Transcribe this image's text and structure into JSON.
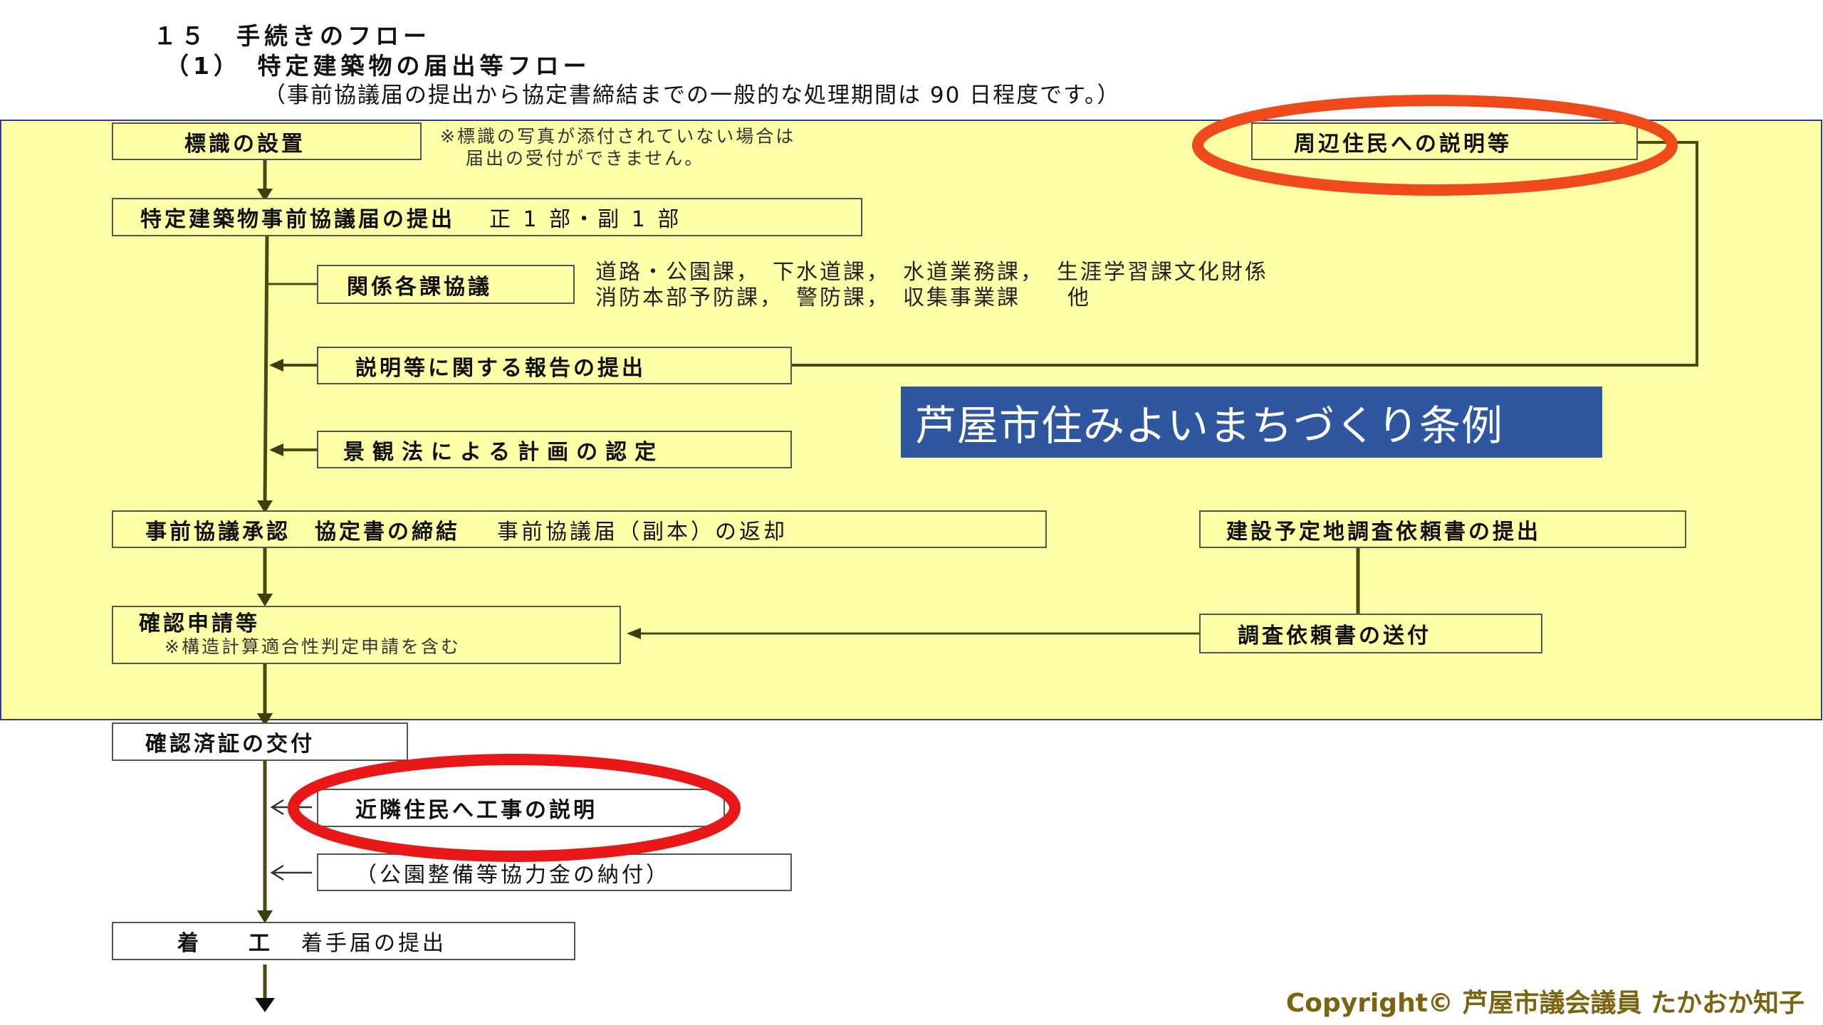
{
  "header": {
    "section": "１５　手続きのフロー",
    "subsection": "（1）　特定建築物の届出等フロー",
    "period_note": "（事前協議届の提出から協定書締結までの一般的な処理期間は 90 日程度です。）"
  },
  "flow": {
    "sign_install": "標識の設置",
    "sign_note_1": "※標識の写真が添付されていない場合は",
    "sign_note_2": "届出の受付ができません。",
    "resident_explain": "周辺住民への説明等",
    "prior_consult_submit": "特定建築物事前協議届の提出",
    "prior_consult_copies": "正 1 部・副 1 部",
    "dept_consult": "関係各課協議",
    "depts_line1": "道路・公園課，　下水道課，　水道業務課，　生涯学習課文化財係",
    "depts_line2": "消防本部予防課，　警防課，　収集事業課　　他",
    "report_submit": "説明等に関する報告の提出",
    "landscape_cert": "景観法による計画の認定",
    "approval": "事前協議承認　協定書の締結",
    "approval_return": "事前協議届（副本）の返却",
    "site_survey_submit": "建設予定地調査依頼書の提出",
    "confirm_apply": "確認申請等",
    "confirm_apply_note": "※構造計算適合性判定申請を含む",
    "survey_send": "調査依頼書の送付",
    "confirm_issue": "確認済証の交付",
    "neighbor_explain": "近隣住民へ工事の説明",
    "park_fee": "（公園整備等協力金の納付）",
    "start_work": "着　工",
    "start_work_notice": "着手届の提出"
  },
  "banner": {
    "text": "芦屋市住みよいまちづくり条例"
  },
  "footer": {
    "copyright": "Copyright© 芦屋市議会議員 たかおか知子"
  },
  "colors": {
    "yellow_area": "#ffffa8",
    "highlight_ring": "#e81818",
    "highlight_ring_top": "#f04a1a",
    "banner_bg": "#2f57a0",
    "connector": "#4a4a10",
    "copyright": "#7a6410"
  }
}
